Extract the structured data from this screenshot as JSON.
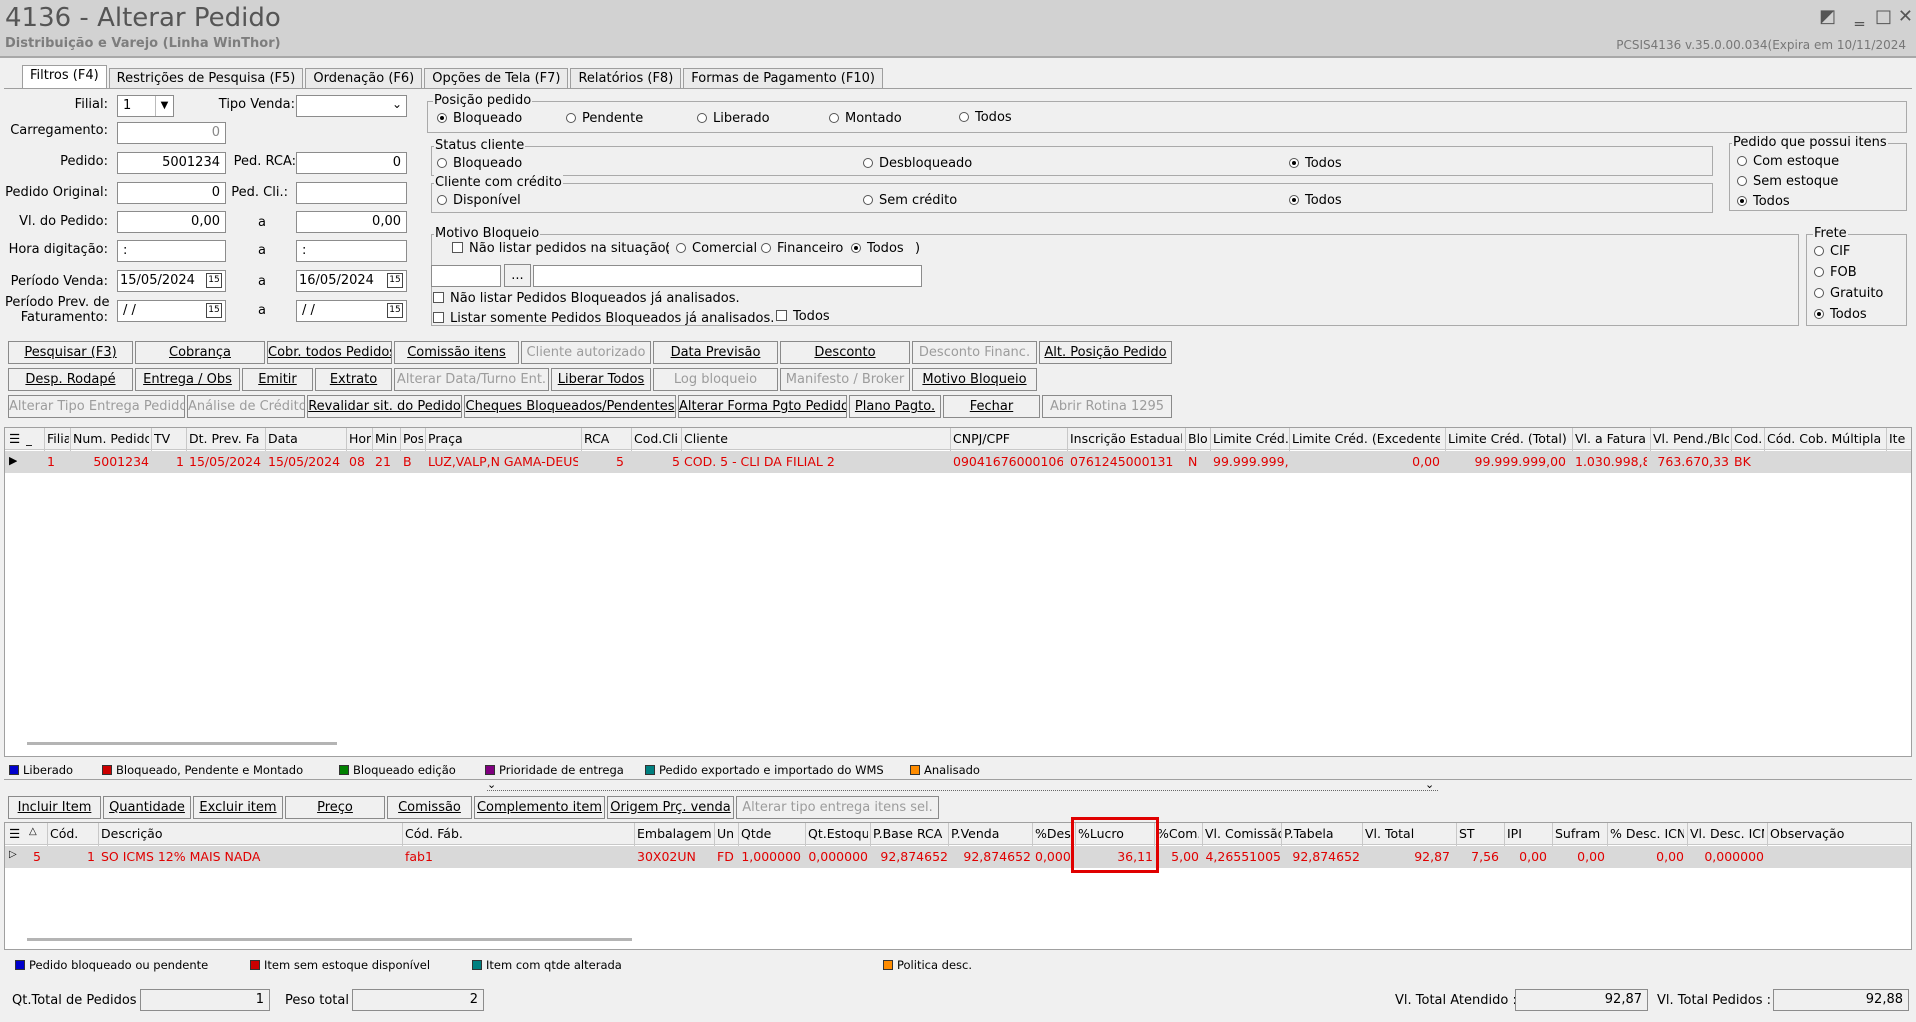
{
  "window": {
    "title": "4136 - Alterar Pedido",
    "subtitle": "Distribuição e Varejo (Linha WinThor)",
    "version": "PCSIS4136  v.35.0.00.034(Expira em 10/11/2024"
  },
  "tabs": [
    "Filtros (F4)",
    "Restrições de Pesquisa (F5)",
    "Ordenação (F6)",
    "Opções de Tela (F7)",
    "Relatórios (F8)",
    "Formas de Pagamento (F10)"
  ],
  "filters": {
    "filial_label": "Filial:",
    "filial_value": "1",
    "tipo_venda_label": "Tipo Venda:",
    "carregamento_label": "Carregamento:",
    "carregamento_value": "0",
    "pedido_label": "Pedido:",
    "pedido_value": "5001234",
    "ped_rca_label": "Ped. RCA:",
    "ped_rca_value": "0",
    "pedido_original_label": "Pedido Original:",
    "pedido_original_value": "0",
    "ped_cli_label": "Ped. Cli.:",
    "vl_pedido_label": "Vl. do Pedido:",
    "vl_pedido_from": "0,00",
    "vl_pedido_to": "0,00",
    "hora_label": "Hora digitação:",
    "hora_from": ":",
    "hora_to": ":",
    "periodo_venda_label": "Período Venda:",
    "periodo_venda_from": "15/05/2024",
    "periodo_venda_to": "16/05/2024",
    "periodo_prev_label1": "Período Prev. de",
    "periodo_prev_label2": "Faturamento:",
    "periodo_prev_from": "/ /",
    "periodo_prev_to": "/ /",
    "a": "a"
  },
  "posicao": {
    "title": "Posição pedido",
    "options": [
      "Bloqueado",
      "Pendente",
      "Liberado",
      "Montado",
      "Todos"
    ],
    "selected": 0
  },
  "status_cliente": {
    "title": "Status cliente",
    "options": [
      "Bloqueado",
      "Desbloqueado",
      "Todos"
    ],
    "selected": 2
  },
  "cliente_credito": {
    "title": "Cliente com crédito",
    "options": [
      "Disponível",
      "Sem crédito",
      "Todos"
    ],
    "selected": 2
  },
  "pedido_itens": {
    "title": "Pedido que possui itens",
    "options": [
      "Com estoque",
      "Sem estoque",
      "Todos"
    ],
    "selected": 2
  },
  "motivo": {
    "title": "Motivo Bloqueio",
    "nao_listar": "Não listar pedidos na situação:",
    "paren_open": "(",
    "paren_close": ")",
    "options": [
      "Comercial",
      "Financeiro",
      "Todos"
    ],
    "selected": 2,
    "ellipsis": "...",
    "chk1": "Não listar Pedidos Bloqueados já analisados.",
    "chk2": "Listar somente Pedidos Bloqueados já analisados.",
    "chk_todos": "Todos"
  },
  "frete": {
    "title": "Frete",
    "options": [
      "CIF",
      "FOB",
      "Gratuito",
      "Todos"
    ],
    "selected": 3
  },
  "buttons_row1": [
    "Pesquisar (F3)",
    "Cobrança",
    "Cobr. todos Pedidos",
    "Comissão itens",
    "Cliente autorizado",
    "Data Previsão",
    "Desconto",
    "Desconto Financ.",
    "Alt. Posição Pedido"
  ],
  "buttons_row2": [
    "Desp. Rodapé",
    "Entrega / Obs",
    "Emitir",
    "Extrato",
    "Alterar Data/Turno Ent.",
    "Liberar Todos",
    "Log bloqueio",
    "Manifesto / Broker",
    "Motivo Bloqueio"
  ],
  "buttons_row3": [
    "Alterar Tipo Entrega Pedido",
    "Análise de Crédito",
    "Revalidar sit. do Pedido",
    "Cheques Bloqueados/Pendentes",
    "Alterar Forma Pgto Pedido",
    "Plano Pagto.",
    "Fechar",
    "Abrir Rotina 1295"
  ],
  "grid1": {
    "headers": [
      "Filia",
      "Num. Pedido",
      "TV",
      "Dt. Prev. Fa",
      "Data",
      "Hor",
      "Min",
      "Pos",
      "Praça",
      "RCA",
      "Cod.Cli",
      "Cliente",
      "CNPJ/CPF",
      "Inscrição Estadual",
      "Blo",
      "Limite Créd.",
      "Limite Créd. (Excedente)",
      "Limite Créd. (Total)",
      "Vl. a Faturar",
      "Vl. Pend./Blo",
      "Cod.",
      "Cód. Cob. Múltipla",
      "Ite"
    ],
    "row": [
      "1",
      "5001234",
      "1",
      "15/05/2024",
      "15/05/2024",
      "08",
      "21",
      "B",
      "LUZ,VALP,N GAMA-DEUS",
      "5",
      "5",
      "COD. 5 - CLI DA FILIAL 2",
      "09041676000106",
      "0761245000131",
      "N",
      "99.999.999,",
      "0,00",
      "99.999.999,00",
      "1.030.998,8",
      "763.670,33",
      "BK",
      "",
      ""
    ]
  },
  "legend1": [
    {
      "color": "#0000cc",
      "label": "Liberado"
    },
    {
      "color": "#cc0000",
      "label": "Bloqueado, Pendente e Montado"
    },
    {
      "color": "#008000",
      "label": "Bloqueado edição"
    },
    {
      "color": "#800080",
      "label": "Prioridade de entrega"
    },
    {
      "color": "#008080",
      "label": "Pedido exportado e importado do WMS"
    },
    {
      "color": "#ff8c00",
      "label": "Analisado"
    }
  ],
  "buttons_row4": [
    "Incluir Item",
    "Quantidade",
    "Excluir item",
    "Preço",
    "Comissão",
    "Complemento item",
    "Origem Prç. venda",
    "Alterar tipo entrega itens sel."
  ],
  "grid2": {
    "headers": [
      "Cód.",
      "Descrição",
      "Cód. Fáb.",
      "Embalagem",
      "Un",
      "Qtde",
      "Qt.Estoque",
      "P.Base RCA",
      "P.Venda",
      "%Des",
      "%Lucro",
      "%Com.",
      "Vl. Comissão",
      "P.Tabela",
      "Vl. Total",
      "ST",
      "IPI",
      "Sufram",
      "% Desc. ICN",
      "Vl. Desc. ICN",
      "Observação"
    ],
    "row": [
      "1",
      "SO ICMS 12% MAIS NADA",
      "fab1",
      "30X02UN",
      "FD",
      "1,000000",
      "0,000000",
      "92,874652",
      "92,874652",
      "0,000",
      "36,11",
      "5,00",
      "4,26551005",
      "92,874652",
      "92,87",
      "7,56",
      "0,00",
      "0,00",
      "0,00",
      "0,000000",
      ""
    ],
    "row_first": "5"
  },
  "legend2": [
    {
      "color": "#0000cc",
      "label": "Pedido bloqueado ou pendente"
    },
    {
      "color": "#cc0000",
      "label": "Item sem estoque disponível"
    },
    {
      "color": "#008080",
      "label": "Item com qtde alterada"
    },
    {
      "color": "#ff8c00",
      "label": "Politica desc."
    }
  ],
  "footer": {
    "qt_total_label": "Qt.Total de Pedidos",
    "qt_total_value": "1",
    "peso_label": "Peso total",
    "peso_value": "2",
    "vl_atendido_label": "Vl. Total Atendido :",
    "vl_atendido_value": "92,87",
    "vl_pedidos_label": "Vl. Total Pedidos :",
    "vl_pedidos_value": "92,88"
  },
  "highlight_color": "#e00000"
}
